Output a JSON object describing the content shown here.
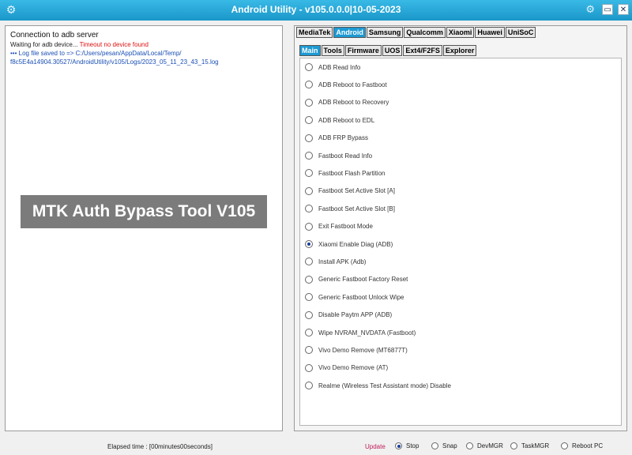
{
  "window": {
    "title": "Android Utility - v105.0.0.0|10-05-2023",
    "controls": {
      "minimize": "▭",
      "close": "✕"
    }
  },
  "log": {
    "line1": "Connection to adb server",
    "line2_prefix": "Waiting for adb device...",
    "line2_error": "Timeout no device found",
    "line3": "••• Log file saved to => C:/Users/pesan/AppData/Local/Temp/",
    "line4": "f8c5E4a14904.30527/AndroidUtility/v105/Logs/2023_05_11_23_43_15.log"
  },
  "banner": {
    "text": "MTK Auth Bypass Tool V105"
  },
  "tabs": [
    {
      "label": "MediaTek",
      "active": false
    },
    {
      "label": "Android",
      "active": true
    },
    {
      "label": "Samsung",
      "active": false
    },
    {
      "label": "Qualcomm",
      "active": false
    },
    {
      "label": "Xiaomi",
      "active": false
    },
    {
      "label": "Huawei",
      "active": false
    },
    {
      "label": "UniSoC",
      "active": false
    }
  ],
  "subtabs": [
    {
      "label": "Main",
      "active": true
    },
    {
      "label": "Tools",
      "active": false
    },
    {
      "label": "Firmware",
      "active": false
    },
    {
      "label": "UOS",
      "active": false
    },
    {
      "label": "Ext4/F2FS",
      "active": false
    },
    {
      "label": "Explorer",
      "active": false
    }
  ],
  "options": [
    {
      "label": "ADB Read Info",
      "checked": false
    },
    {
      "label": "ADB Reboot to Fastboot",
      "checked": false
    },
    {
      "label": "ADB Reboot to Recovery",
      "checked": false
    },
    {
      "label": "ADB Reboot to EDL",
      "checked": false
    },
    {
      "label": "ADB FRP Bypass",
      "checked": false
    },
    {
      "label": "Fastboot Read Info",
      "checked": false
    },
    {
      "label": "Fastboot Flash Partition",
      "checked": false
    },
    {
      "label": "Fastboot Set Active Slot [A]",
      "checked": false
    },
    {
      "label": "Fastboot Set Active Slot [B]",
      "checked": false
    },
    {
      "label": "Exit Fastboot Mode",
      "checked": false
    },
    {
      "label": "Xiaomi Enable Diag (ADB)",
      "checked": true
    },
    {
      "label": "Install APK (Adb)",
      "checked": false
    },
    {
      "label": "Generic Fastboot Factory Reset",
      "checked": false
    },
    {
      "label": "Generic Fastboot Unlock Wipe",
      "checked": false
    },
    {
      "label": "Disable Paytm APP (ADB)",
      "checked": false
    },
    {
      "label": "Wipe NVRAM_NVDATA (Fastboot)",
      "checked": false
    },
    {
      "label": "Vivo Demo Remove (MT6877T)",
      "checked": false
    },
    {
      "label": "Vivo Demo Remove (AT)",
      "checked": false
    },
    {
      "label": "Realme (Wireless Test Assistant mode) Disable",
      "checked": false
    }
  ],
  "status": {
    "elapsed": "Elapsed time : [00minutes00seconds]",
    "update": "Update",
    "items": [
      {
        "label": "Stop",
        "checked": true
      },
      {
        "label": "Snap",
        "checked": false
      },
      {
        "label": "DevMGR",
        "checked": false
      },
      {
        "label": "TaskMGR",
        "checked": false
      },
      {
        "label": "Reboot PC",
        "checked": false
      }
    ]
  }
}
